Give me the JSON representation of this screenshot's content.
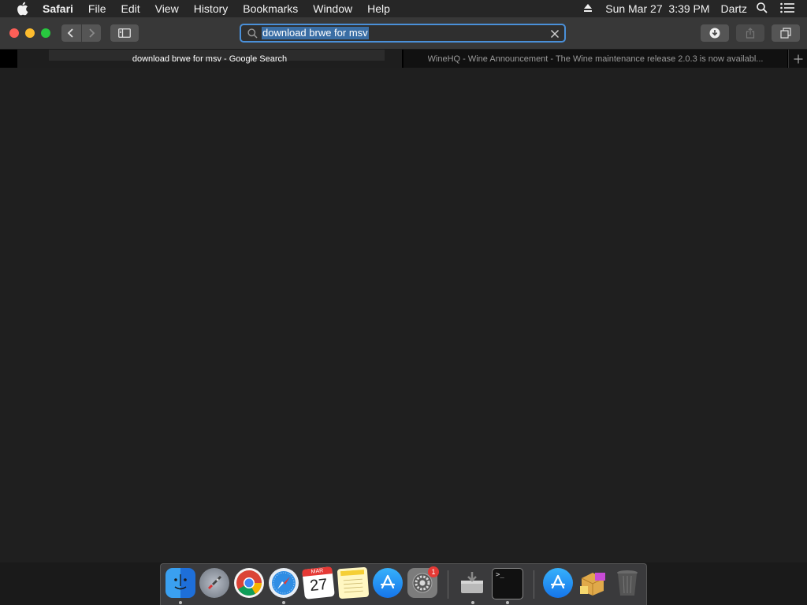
{
  "menubar": {
    "app_name": "Safari",
    "items": [
      "File",
      "Edit",
      "View",
      "History",
      "Bookmarks",
      "Window",
      "Help"
    ],
    "clock": "Sun Mar 27  3:39 PM",
    "user": "Dartz"
  },
  "toolbar": {
    "address_query": "download brwe for msv"
  },
  "tabs": [
    {
      "title": "download brwe for msv - Google Search",
      "active": true
    },
    {
      "title": "WineHQ - Wine Announcement - The Wine maintenance release 2.0.3 is now availabl...",
      "active": false
    }
  ],
  "dock": {
    "calendar_month": "MAR",
    "calendar_day": "27",
    "system_prefs_badge": "1",
    "terminal_prompt": ">_"
  },
  "colors": {
    "accent": "#4a90d9",
    "close": "#fc5f57",
    "minimize": "#fdbc2e",
    "maximize": "#28c83f"
  }
}
